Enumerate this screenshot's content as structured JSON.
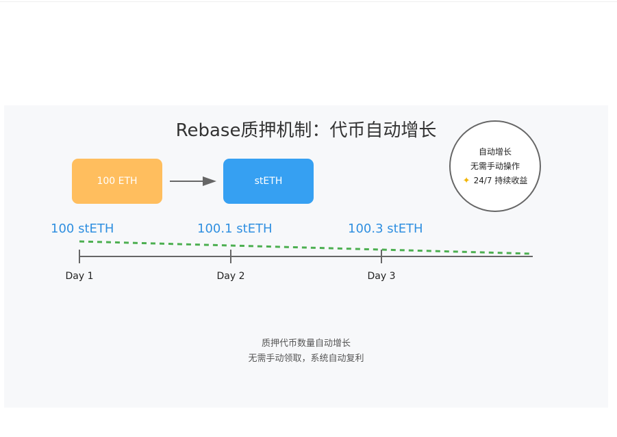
{
  "title": "Rebase质押机制：代币自动增长",
  "flow": {
    "source_label": "100 ETH",
    "target_label": "stETH"
  },
  "badge": {
    "line1": "自动增长",
    "line2": "无需手动操作",
    "line3": "24/7 持续收益",
    "icon": "sparkle-icon"
  },
  "timeline": {
    "values": [
      "100 stETH",
      "100.1 stETH",
      "100.3 stETH"
    ],
    "days": [
      "Day 1",
      "Day 2",
      "Day 3"
    ]
  },
  "caption": {
    "line1": "质押代币数量自动增长",
    "line2": "无需手动领取，系统自动复利"
  },
  "colors": {
    "eth_box": "#ffbe5e",
    "steth_box": "#36a0f2",
    "growth_line": "#4caf50",
    "value_text": "#2f8fe0"
  }
}
